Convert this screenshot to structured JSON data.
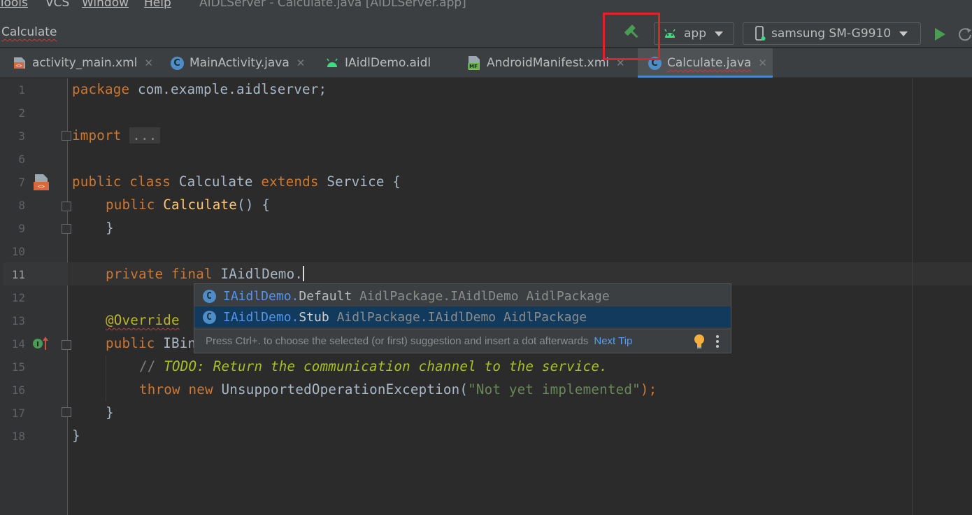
{
  "menu": {
    "items": [
      {
        "label": "Tools",
        "mnemonic_index": 0
      },
      {
        "label": "VCS",
        "mnemonic_index": 2
      },
      {
        "label": "Window",
        "mnemonic_index": 0
      },
      {
        "label": "Help",
        "mnemonic_index": 0
      }
    ],
    "window_title": "AIDLServer - Calculate.java [AIDLServer.app]"
  },
  "toolbar": {
    "breadcrumb": "Calculate",
    "build_icon": "hammer-icon",
    "run_config": "app",
    "device": "samsung SM-G9910",
    "run_icon": "run-triangle-icon",
    "highlight_color": "#e0222b"
  },
  "tabs": [
    {
      "label": "activity_main.xml",
      "icon": "xml-layout-icon",
      "active": false
    },
    {
      "label": "MainActivity.java",
      "icon": "class-icon",
      "active": false
    },
    {
      "label": "IAidlDemo.aidl",
      "icon": "android-icon",
      "active": false
    },
    {
      "label": "AndroidManifest.xml",
      "icon": "manifest-icon",
      "active": false
    },
    {
      "label": "Calculate.java",
      "icon": "class-icon",
      "active": true
    }
  ],
  "editor": {
    "line_numbers": [
      "1",
      "2",
      "3",
      "6",
      "7",
      "8",
      "9",
      "10",
      "11",
      "12",
      "13",
      "14",
      "15",
      "16",
      "17",
      "18"
    ],
    "current_line": "11",
    "code": {
      "l1_kw": "package",
      "l1_rest": " com.example.aidlserver;",
      "l3_kw": "import",
      "l3_fold": "...",
      "l7_kw1": "public",
      "l7_kw2": "class",
      "l7_name": "Calculate",
      "l7_kw3": "extends",
      "l7_rest": " Service {",
      "l8_kw": "public",
      "l8_fn": "Calculate",
      "l8_rest": "() {",
      "l9": "}",
      "l11_kw1": "private",
      "l11_kw2": "final",
      "l11_rest": " IAidlDemo.",
      "l13_ann": "@Override",
      "l14_kw": "public",
      "l14_rest": " IBin",
      "l15_cmt": "// ",
      "l15_todo": "TODO: Return the communication channel to the service.",
      "l16_kw1": "throw",
      "l16_kw2": "new",
      "l16_name": " UnsupportedOperationException(",
      "l16_str": "\"Not yet implemented\"",
      "l16_end": ");",
      "l17": "}",
      "l18": "}"
    }
  },
  "completion": {
    "items": [
      {
        "owner": "IAidlDemo.",
        "name": "Default",
        "tail": " AidlPackage.IAidlDemo AidlPackage",
        "selected": false
      },
      {
        "owner": "IAidlDemo.",
        "name": "Stub",
        "tail": " AidlPackage.IAidlDemo AidlPackage",
        "selected": true
      }
    ],
    "hint": "Press Ctrl+. to choose the selected (or first) suggestion and insert a dot afterwards",
    "next_tip": "Next Tip"
  }
}
